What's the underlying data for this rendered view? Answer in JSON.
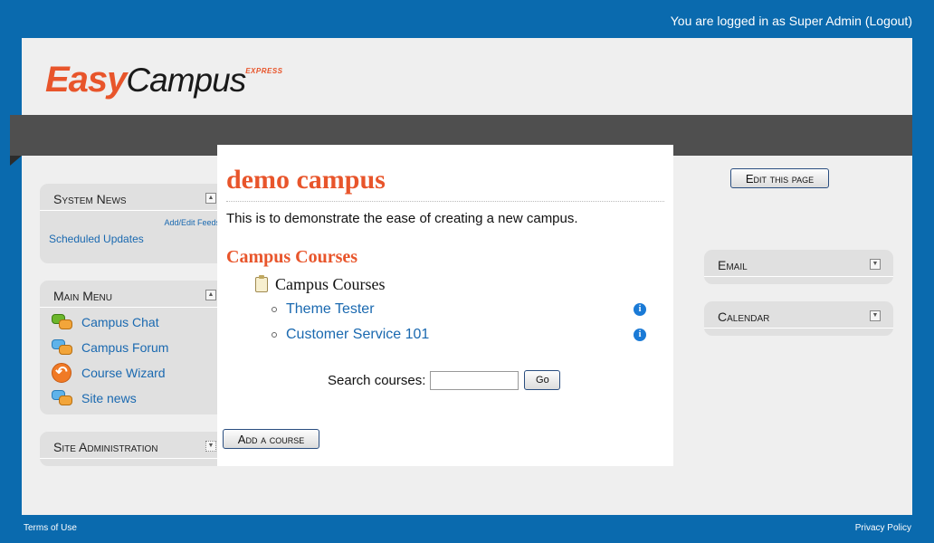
{
  "header": {
    "login_text": "You are logged in as Super Admin",
    "logout_label": "(Logout)",
    "logo_easy": "Easy",
    "logo_campus": "Campus",
    "logo_express": "EXPRESS"
  },
  "left": {
    "system_news": {
      "title": "System News",
      "feeds_link": "Add/Edit Feeds",
      "scheduled_link": "Scheduled Updates"
    },
    "main_menu": {
      "title": "Main Menu",
      "items": [
        {
          "label": "Campus Chat",
          "icon": "chat-icon"
        },
        {
          "label": "Campus Forum",
          "icon": "forum-icon"
        },
        {
          "label": "Course Wizard",
          "icon": "wizard-icon"
        },
        {
          "label": "Site news",
          "icon": "forum-icon"
        }
      ]
    },
    "site_admin": {
      "title": "Site Administration"
    }
  },
  "main": {
    "title": "demo campus",
    "summary": "This is to demonstrate the ease of creating a new campus.",
    "subtitle": "Campus Courses",
    "category": "Campus Courses",
    "courses": [
      {
        "name": "Theme Tester"
      },
      {
        "name": "Customer Service 101"
      }
    ],
    "search_label": "Search courses:",
    "search_value": "",
    "go_label": "Go",
    "add_course_label": "Add a course"
  },
  "right": {
    "edit_page_label": "Edit this page",
    "email": {
      "title": "Email"
    },
    "calendar": {
      "title": "Calendar"
    }
  },
  "footer": {
    "terms": "Terms of Use",
    "privacy": "Privacy Policy"
  },
  "colors": {
    "frame_blue": "#0a6aae",
    "brand_orange": "#e8552b",
    "link_blue": "#1a69b0",
    "nav_gray": "#4f4f4f"
  }
}
